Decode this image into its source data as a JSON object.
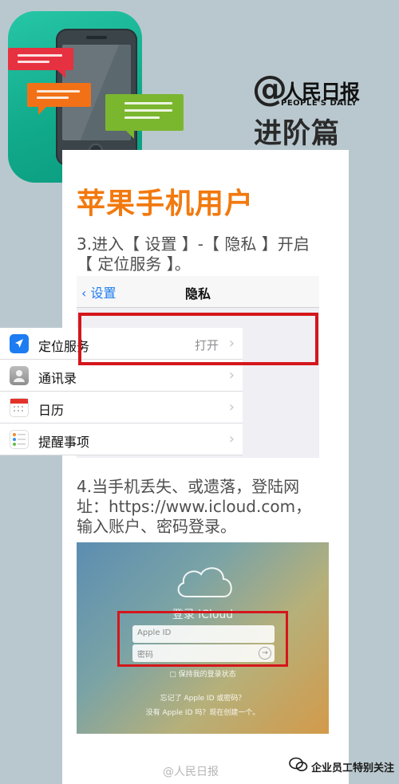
{
  "brand": {
    "at": "@",
    "name": "人民日报",
    "sub": "PEOPLE'S DAILY",
    "series": "进阶篇"
  },
  "title": "苹果手机用户",
  "step3": {
    "line1": "3.进入【 设置 】-【 隐私 】开启",
    "line2": "【 定位服务 】。"
  },
  "settings": {
    "back_label": "设置",
    "page_title": "隐私",
    "rows": [
      {
        "label": "定位服务",
        "value": "打开"
      },
      {
        "label": "通讯录",
        "value": ""
      },
      {
        "label": "日历",
        "value": ""
      },
      {
        "label": "提醒事项",
        "value": ""
      }
    ]
  },
  "step4": {
    "line1": "4.当手机丢失、或遗落，登陆网",
    "line2": "址：https://www.icloud.com，",
    "line3": "输入账户、密码登录。"
  },
  "icloud": {
    "title": "登录 iCloud",
    "apple_id_placeholder": "Apple ID",
    "password_placeholder": "密码",
    "keep_signed_in": "保持我的登录状态",
    "forgot": "忘记了 Apple ID 或密码？",
    "no_id": "没有 Apple ID 吗？现在创建一个。"
  },
  "footer": {
    "weibo_watermark": "@人民日报",
    "wechat_account": "企业员工特别关注"
  },
  "colors": {
    "title_orange": "#f2790f",
    "highlight_red": "#d4161b",
    "ios_blue": "#1d7cf2"
  }
}
